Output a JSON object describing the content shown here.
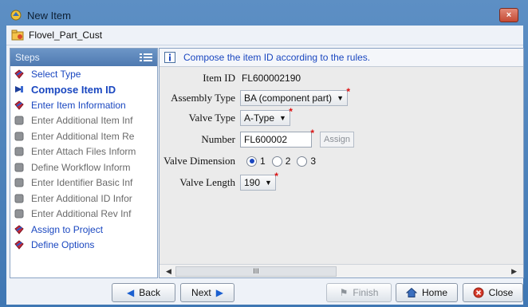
{
  "window": {
    "title": "New Item",
    "close_glyph": "×"
  },
  "subheader": {
    "object_name": "Flovel_Part_Cust"
  },
  "steps": {
    "header": "Steps",
    "items": [
      {
        "label": "Select Type",
        "state": "done"
      },
      {
        "label": "Compose Item ID",
        "state": "current"
      },
      {
        "label": "Enter Item Information",
        "state": "done"
      },
      {
        "label": "Enter Additional Item Inf",
        "state": "pending"
      },
      {
        "label": "Enter Additional Item Re",
        "state": "pending"
      },
      {
        "label": "Enter Attach Files Inform",
        "state": "pending"
      },
      {
        "label": "Define Workflow Inform",
        "state": "pending"
      },
      {
        "label": "Enter Identifier Basic Inf",
        "state": "pending"
      },
      {
        "label": "Enter Additional ID Infor",
        "state": "pending"
      },
      {
        "label": "Enter Additional Rev Inf",
        "state": "pending"
      },
      {
        "label": "Assign to Project",
        "state": "done"
      },
      {
        "label": "Define Options",
        "state": "done"
      }
    ]
  },
  "main": {
    "instruction": "Compose the item ID according to the rules.",
    "fields": {
      "item_id": {
        "label": "Item ID",
        "value": "FL600002190"
      },
      "assembly_type": {
        "label": "Assembly Type",
        "value": "BA (component part)"
      },
      "valve_type": {
        "label": "Valve Type",
        "value": "A-Type"
      },
      "number": {
        "label": "Number",
        "value": "FL600002",
        "assign_label": "Assign"
      },
      "valve_dimension": {
        "label": "Valve Dimension",
        "options": [
          "1",
          "2",
          "3"
        ],
        "selected": "1"
      },
      "valve_length": {
        "label": "Valve Length",
        "value": "190"
      }
    },
    "required_marker": "*",
    "scrollbar_grip": "III"
  },
  "footer": {
    "back": "Back",
    "next": "Next",
    "finish": "Finish",
    "home": "Home",
    "close": "Close"
  },
  "colors": {
    "accent": "#1a47c0",
    "required": "#dd1111",
    "title_bg": "#3f77b3"
  }
}
